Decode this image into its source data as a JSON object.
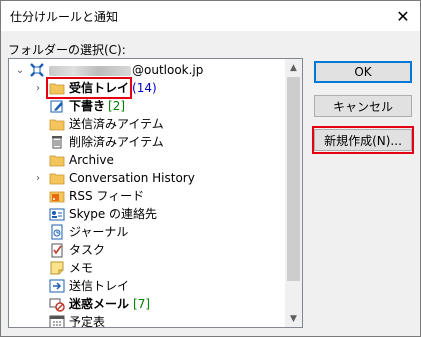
{
  "window": {
    "title": "仕分けルールと通知",
    "close_glyph": "✕"
  },
  "folder_select_label": "フォルダーの選択(C):",
  "tree": {
    "account": {
      "suffix": "@outlook.jp",
      "expander": "⌄"
    },
    "items": [
      {
        "label": "受信トレイ",
        "count": "(14)",
        "icon": "inbox-icon",
        "bold": true,
        "expander": "›"
      },
      {
        "label": "下書き",
        "count": "[2]",
        "icon": "drafts-icon",
        "bold": true
      },
      {
        "label": "送信済みアイテム",
        "icon": "sent-items-icon"
      },
      {
        "label": "削除済みアイテム",
        "icon": "trash-icon"
      },
      {
        "label": "Archive",
        "icon": "folder-icon"
      },
      {
        "label": "Conversation History",
        "icon": "folder-icon",
        "expander": "›"
      },
      {
        "label": "RSS フィード",
        "icon": "rss-icon"
      },
      {
        "label": "Skype の連絡先",
        "icon": "contacts-icon"
      },
      {
        "label": "ジャーナル",
        "icon": "journal-icon"
      },
      {
        "label": "タスク",
        "icon": "tasks-icon"
      },
      {
        "label": "メモ",
        "icon": "notes-icon"
      },
      {
        "label": "送信トレイ",
        "icon": "outbox-icon"
      },
      {
        "label": "迷惑メール",
        "count": "[7]",
        "icon": "junk-mail-icon",
        "bold": true
      },
      {
        "label": "予定表",
        "icon": "calendar-icon"
      }
    ]
  },
  "scrollbar": {
    "up": "▲",
    "down": "▼"
  },
  "buttons": {
    "ok": "OK",
    "cancel": "キャンセル",
    "new": "新規作成(N)..."
  },
  "colors": {
    "highlight": "#e60012",
    "count_blue": "#0000cc",
    "count_green": "#008000",
    "folder": "#f4c55c"
  }
}
